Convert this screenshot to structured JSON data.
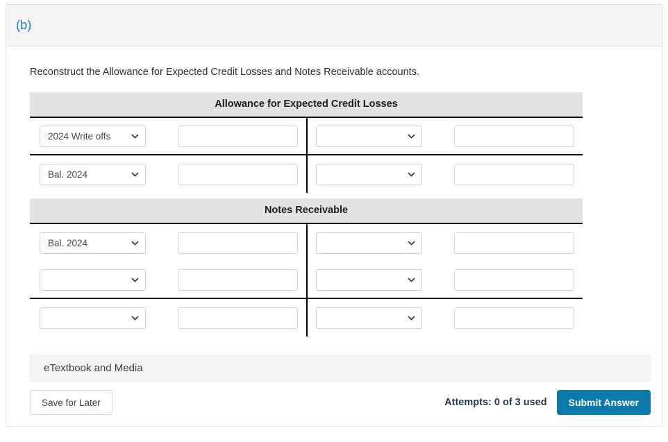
{
  "card": {
    "part_label": "(b)",
    "instruction": "Reconstruct the Allowance for Expected Credit Losses and Notes Receivable accounts."
  },
  "colors": {
    "accent_blue": "#1a7eb8",
    "submit_button": "#0b7aa8",
    "title_bar": "#e2e2e2",
    "header_band": "#f4f4f4",
    "rule": "#000000"
  },
  "icons": {
    "chevron_down": "chevron-down-icon"
  },
  "taccounts": [
    {
      "title": "Allowance for Expected Credit Losses",
      "rows": [
        {
          "ruled": true,
          "debit_select": "2024 Write offs",
          "debit_amount": "",
          "credit_select": "",
          "credit_amount": ""
        },
        {
          "ruled": false,
          "debit_select": "Bal. 2024",
          "debit_amount": "",
          "credit_select": "",
          "credit_amount": ""
        }
      ]
    },
    {
      "title": "Notes Receivable",
      "rows": [
        {
          "ruled": false,
          "debit_select": "Bal. 2024",
          "debit_amount": "",
          "credit_select": "",
          "credit_amount": ""
        },
        {
          "ruled": true,
          "debit_select": "",
          "debit_amount": "",
          "credit_select": "",
          "credit_amount": ""
        },
        {
          "ruled": false,
          "debit_select": "",
          "debit_amount": "",
          "credit_select": "",
          "credit_amount": ""
        }
      ]
    }
  ],
  "footer": {
    "etextbook_label": "eTextbook and Media",
    "save_label": "Save for Later",
    "attempts_label": "Attempts: 0 of 3 used",
    "submit_label": "Submit Answer"
  }
}
